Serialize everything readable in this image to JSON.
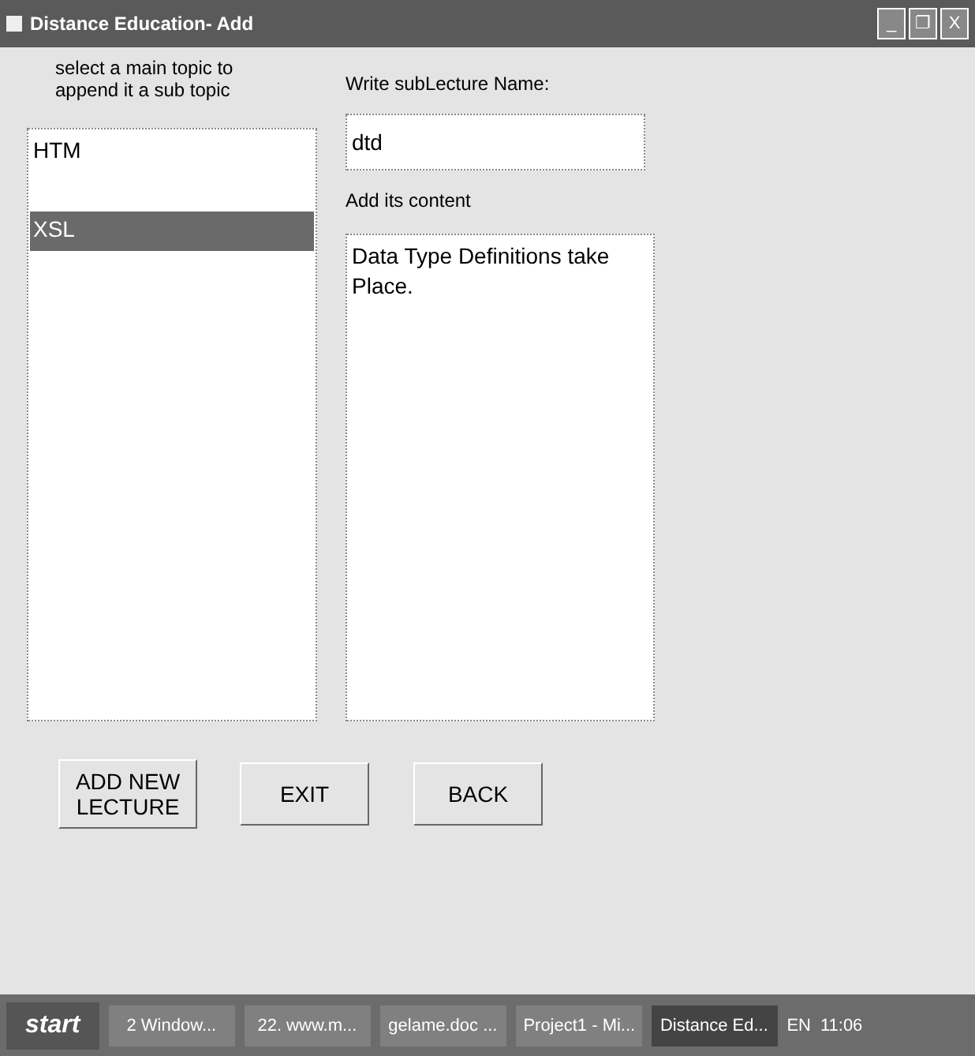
{
  "window": {
    "title": "Distance Education- Add",
    "controls": [
      "_",
      "❐",
      "X"
    ]
  },
  "topic_label": "select a main topic to append it a sub topic",
  "topics": [
    {
      "label": "HTM",
      "selected": false
    },
    {
      "label": "XSL",
      "selected": true
    }
  ],
  "name_label": "Write subLecture Name:",
  "name_field": {
    "value": "dtd"
  },
  "content_label": "Add its content",
  "content_field": {
    "value": "Data Type Definitions take Place."
  },
  "buttons": [
    "ADD NEW LECTURE",
    "EXIT",
    "BACK"
  ],
  "taskbar": {
    "start": "start",
    "items": [
      {
        "label": "2 Window...",
        "selected": false
      },
      {
        "label": "22. www.m...",
        "selected": false
      },
      {
        "label": "gelame.doc ...",
        "selected": false
      },
      {
        "label": "Project1 - Mi...",
        "selected": false
      },
      {
        "label": "Distance Ed...",
        "selected": true
      }
    ],
    "language": "EN",
    "clock": "11:06"
  }
}
